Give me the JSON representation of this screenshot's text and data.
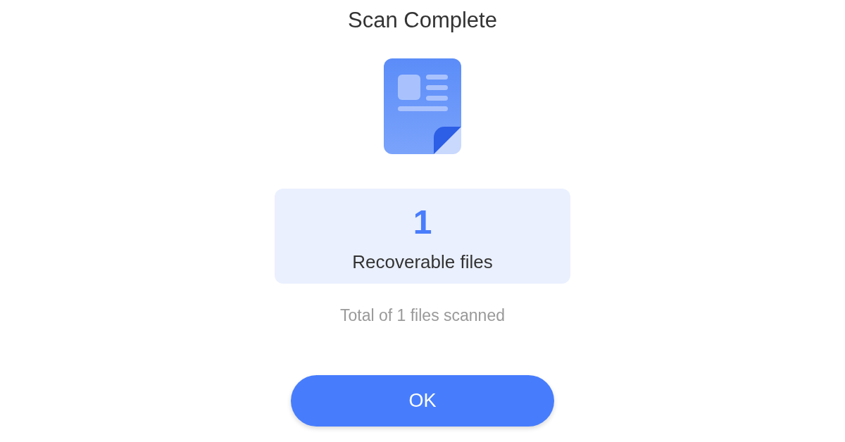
{
  "title": "Scan Complete",
  "result": {
    "count": "1",
    "label": "Recoverable files"
  },
  "summary": "Total of 1 files scanned",
  "buttons": [
    "OK"
  ]
}
